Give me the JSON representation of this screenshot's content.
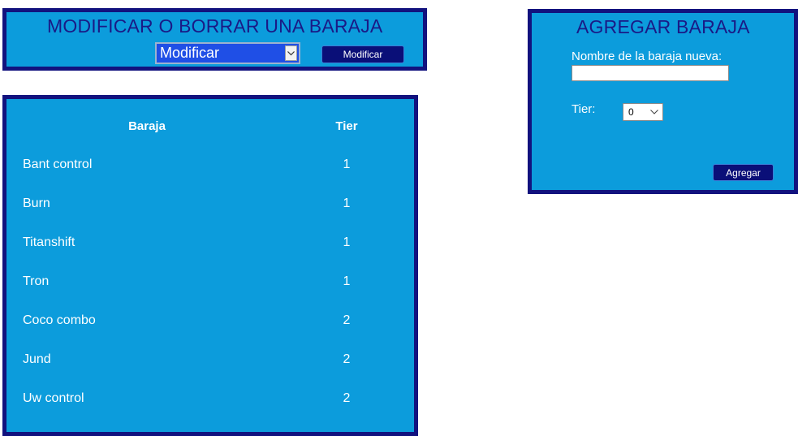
{
  "modify_panel": {
    "title": "MODIFICAR O BORRAR UNA BARAJA",
    "action_select": {
      "selected": "Modificar"
    },
    "button_label": "Modificar"
  },
  "add_panel": {
    "title": "AGREGAR BARAJA",
    "name_label": "Nombre de la baraja nueva:",
    "name_value": "",
    "tier_label": "Tier:",
    "tier_select": {
      "selected": "0"
    },
    "button_label": "Agregar"
  },
  "table": {
    "headers": {
      "name": "Baraja",
      "tier": "Tier"
    },
    "rows": [
      {
        "name": "Bant control",
        "tier": "1"
      },
      {
        "name": "Burn",
        "tier": "1"
      },
      {
        "name": "Titanshift",
        "tier": "1"
      },
      {
        "name": "Tron",
        "tier": "1"
      },
      {
        "name": "Coco combo",
        "tier": "2"
      },
      {
        "name": "Jund",
        "tier": "2"
      },
      {
        "name": "Uw control",
        "tier": "2"
      }
    ]
  },
  "colors": {
    "panel_bg": "#0c9cdc",
    "panel_border": "#12127e",
    "button_bg": "#0a0f78",
    "title_text": "#1a1a86",
    "select_bg": "#1f4fe6"
  }
}
